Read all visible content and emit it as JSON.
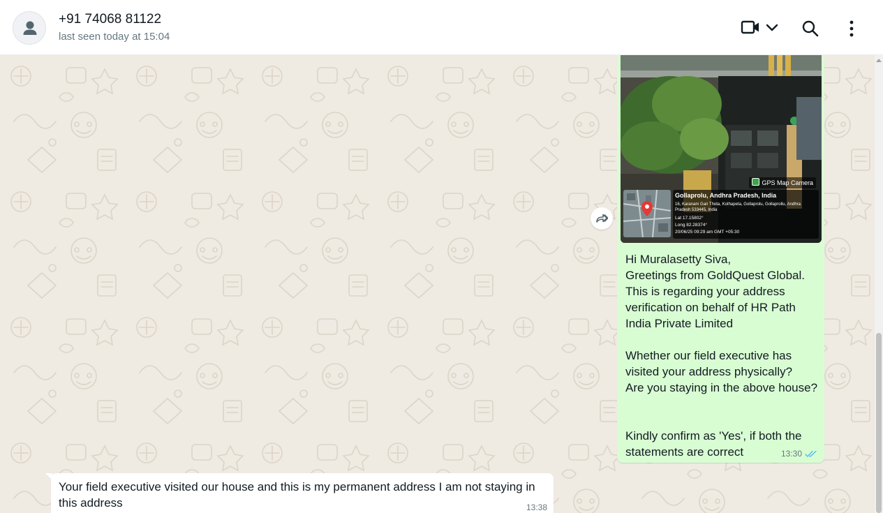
{
  "header": {
    "contact_name": "+91 74068 81122",
    "last_seen": "last seen today at 15:04",
    "icons": [
      "default-avatar-icon",
      "video-call-icon",
      "chevron-down-icon",
      "search-icon",
      "menu-kebab-icon"
    ]
  },
  "colors": {
    "chat_background": "#efeae2",
    "outgoing_bubble": "#d9fdd3",
    "incoming_bubble": "#ffffff",
    "read_receipt": "#53bdeb",
    "text_primary": "#111b21",
    "text_secondary": "#667781"
  },
  "messages": [
    {
      "direction": "outgoing",
      "attachment": {
        "type": "image",
        "gps_brand": "GPS Map Camera",
        "location_title": "Gollaprolu, Andhra Pradesh, India",
        "address": "16, Karanam Gari Thota, Kothapeta, Gollaprolu, Gollaprollu, Andhra Pradesh 533445, India",
        "lat": "Lat 17.15802°",
        "long": "Long 82.28374°",
        "datetime": "20/06/25 09:29 am GMT +05:30"
      },
      "lines": [
        "Hi Muralasetty Siva,",
        "Greetings from GoldQuest Global.",
        "This is regarding your address",
        "verification on behalf of HR Path",
        "India Private Limited",
        "",
        "Whether our field executive has",
        "visited your address physically?",
        "Are you staying in the above house?",
        "",
        "",
        "Kindly confirm as 'Yes', if both the",
        "statements are correct"
      ],
      "time": "13:30",
      "status_icon": "double-check-read-icon"
    },
    {
      "direction": "incoming",
      "text": "Your field executive visited our house and this is my permanent address I am not staying in this address",
      "time": "13:38"
    }
  ]
}
